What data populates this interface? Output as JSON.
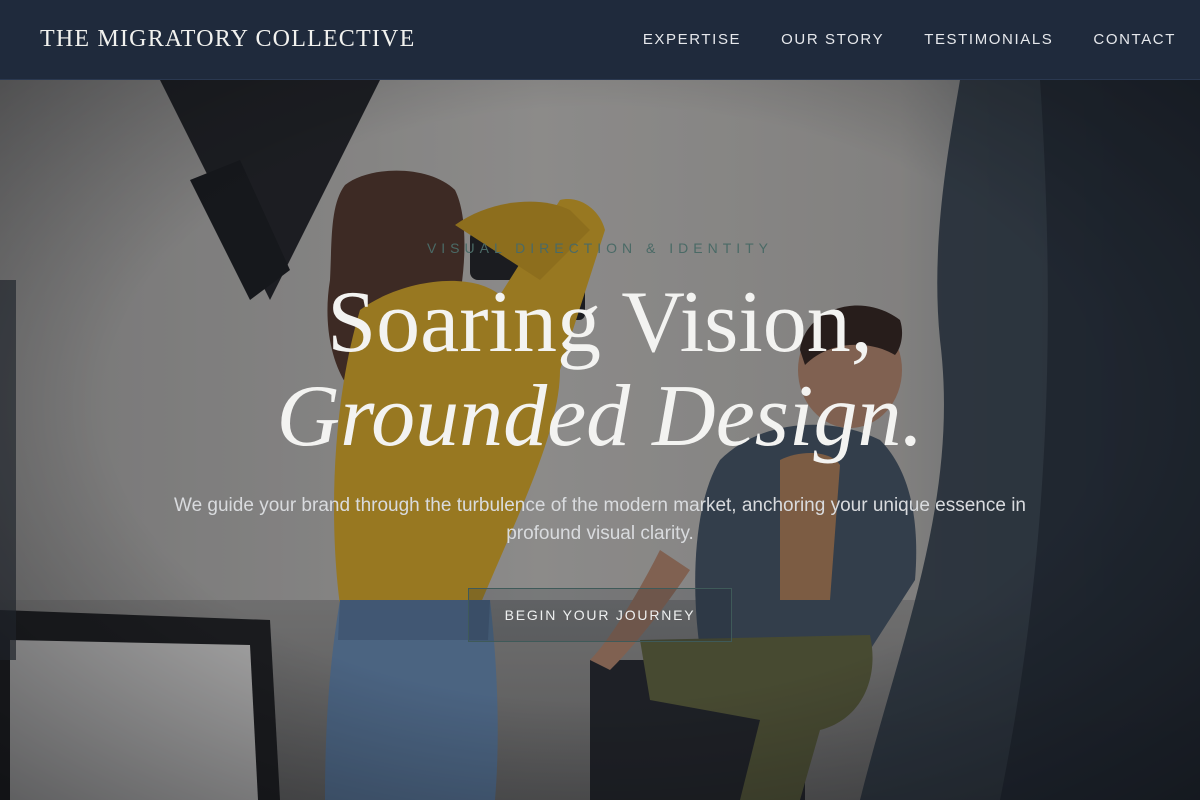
{
  "header": {
    "brand": "THE MIGRATORY COLLECTIVE",
    "nav": [
      "EXPERTISE",
      "OUR STORY",
      "TESTIMONIALS",
      "CONTACT"
    ]
  },
  "hero": {
    "eyebrow": "VISUAL DIRECTION & IDENTITY",
    "headline_line1": "Soaring Vision,",
    "headline_line2": "Grounded Design.",
    "subtitle": "We guide your brand through the turbulence of the modern market, anchoring your unique essence in profound visual clarity.",
    "cta_label": "BEGIN YOUR JOURNEY"
  },
  "colors": {
    "nav_background": "#1f2a3c",
    "eyebrow_accent": "#4a6a66",
    "cta_border": "#3f5a59"
  }
}
